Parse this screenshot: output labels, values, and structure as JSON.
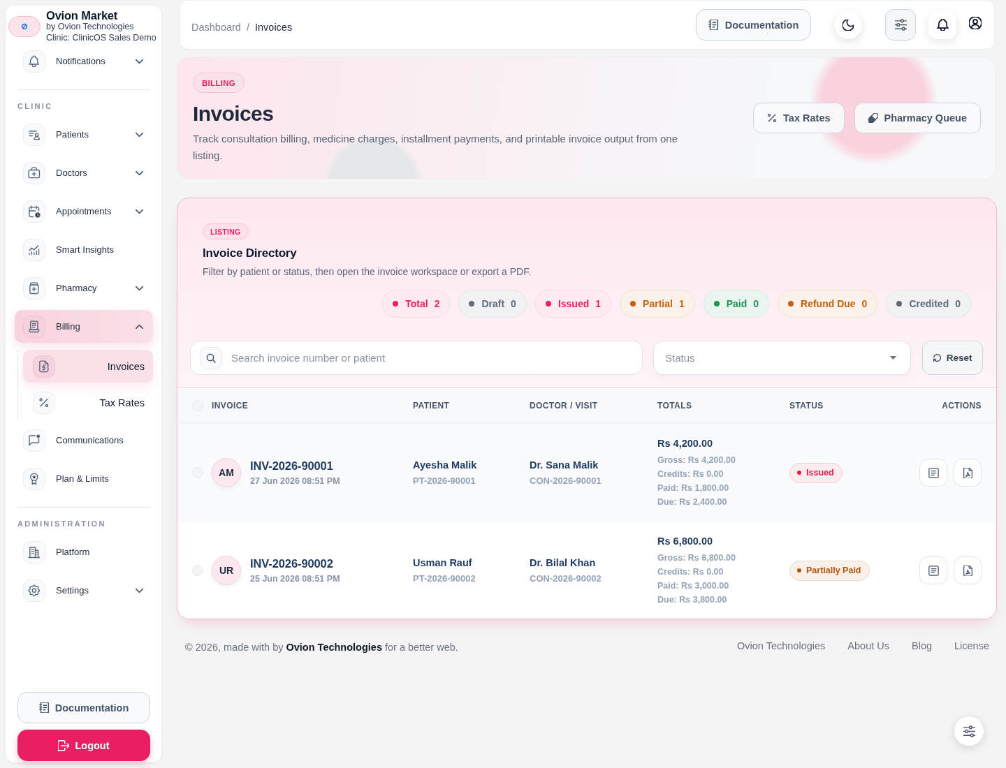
{
  "sidebar": {
    "brand": {
      "title": "Ovion Market",
      "subtitle": "by Ovion Technologies",
      "clinic": "Clinic: ClinicOS Sales Demo"
    },
    "items": [
      {
        "label": "Notifications",
        "kind": "group",
        "expanded": false,
        "selected": false
      }
    ],
    "sections": [
      {
        "title": "CLINIC",
        "items": [
          {
            "label": "Patients",
            "kind": "group",
            "expanded": false,
            "selected": false
          },
          {
            "label": "Doctors",
            "kind": "group",
            "expanded": false,
            "selected": false
          },
          {
            "label": "Appointments",
            "kind": "group",
            "expanded": false,
            "selected": false
          },
          {
            "label": "Smart Insights",
            "kind": "link",
            "selected": false
          },
          {
            "label": "Pharmacy",
            "kind": "group",
            "expanded": false,
            "selected": false
          },
          {
            "label": "Billing",
            "kind": "group",
            "expanded": true,
            "selected": true,
            "children": [
              {
                "label": "Invoices",
                "selected": true
              },
              {
                "label": "Tax Rates",
                "selected": false
              }
            ]
          },
          {
            "label": "Communications",
            "kind": "link",
            "selected": false
          },
          {
            "label": "Plan & Limits",
            "kind": "link",
            "selected": false
          }
        ]
      },
      {
        "title": "ADMINISTRATION",
        "items": [
          {
            "label": "Platform",
            "kind": "link",
            "selected": false
          },
          {
            "label": "Settings",
            "kind": "group",
            "expanded": false,
            "selected": false
          }
        ]
      }
    ],
    "footer_buttons": [
      {
        "label": "Documentation",
        "kind": "secondary"
      },
      {
        "label": "Logout",
        "kind": "danger"
      }
    ]
  },
  "topbar": {
    "breadcrumb": {
      "items": [
        "Dashboard",
        "Invoices"
      ],
      "separator": "/"
    },
    "documentation": "Documentation"
  },
  "hero": {
    "badge": "BILLING",
    "title": "Invoices",
    "description": "Track consultation billing, medicine charges, installment payments, and printable invoice output from one listing.",
    "actions": [
      "Tax Rates",
      "Pharmacy Queue"
    ]
  },
  "listing": {
    "badge": "LISTING",
    "title": "Invoice Directory",
    "description": "Filter by patient or status, then open the invoice workspace or export a PDF.",
    "stats": [
      {
        "label": "Total",
        "count": "2",
        "color": "#e91e63"
      },
      {
        "label": "Draft",
        "count": "0",
        "color": "#5f6b7a"
      },
      {
        "label": "Issued",
        "count": "1",
        "color": "#e91e63"
      },
      {
        "label": "Partial",
        "count": "1",
        "color": "#c2620f"
      },
      {
        "label": "Paid",
        "count": "0",
        "color": "#1f9255"
      },
      {
        "label": "Refund Due",
        "count": "0",
        "color": "#c2620f"
      },
      {
        "label": "Credited",
        "count": "0",
        "color": "#5f6b7a"
      }
    ],
    "search": {
      "placeholder": "Search invoice number or patient"
    },
    "status_filter": {
      "placeholder": "Status"
    },
    "reset": "Reset",
    "table": {
      "select_all": {
        "checked": false
      },
      "columns": [
        "INVOICE",
        "PATIENT",
        "DOCTOR / VISIT",
        "TOTALS",
        "STATUS",
        "ACTIONS"
      ],
      "rows": [
        {
          "checked": false,
          "initials": "AM",
          "invoice": "INV-2026-90001",
          "date": "27 Jun 2026 08:51 PM",
          "patient": "Ayesha Malik",
          "patient_id": "PT-2026-90001",
          "doctor": "Dr. Sana Malik",
          "visit": "CON-2026-90001",
          "total": "Rs 4,200.00",
          "breakdown": [
            "Gross: Rs 4,200.00",
            "Credits: Rs 0.00",
            "Paid: Rs 1,800.00",
            "Due: Rs 2,400.00"
          ],
          "status": {
            "label": "Issued",
            "color": "#e11d48"
          }
        },
        {
          "checked": false,
          "initials": "UR",
          "invoice": "INV-2026-90002",
          "date": "25 Jun 2026 08:51 PM",
          "patient": "Usman Rauf",
          "patient_id": "PT-2026-90002",
          "doctor": "Dr. Bilal Khan",
          "visit": "CON-2026-90002",
          "total": "Rs 6,800.00",
          "breakdown": [
            "Gross: Rs 6,800.00",
            "Credits: Rs 0.00",
            "Paid: Rs 3,000.00",
            "Due: Rs 3,800.00"
          ],
          "status": {
            "label": "Partially Paid",
            "color": "#b45309"
          }
        }
      ]
    }
  },
  "footer": {
    "text": "© 2026, made with by **Ovion Technologies** for a better web.",
    "links": [
      "Ovion Technologies",
      "About Us",
      "Blog",
      "License"
    ]
  }
}
